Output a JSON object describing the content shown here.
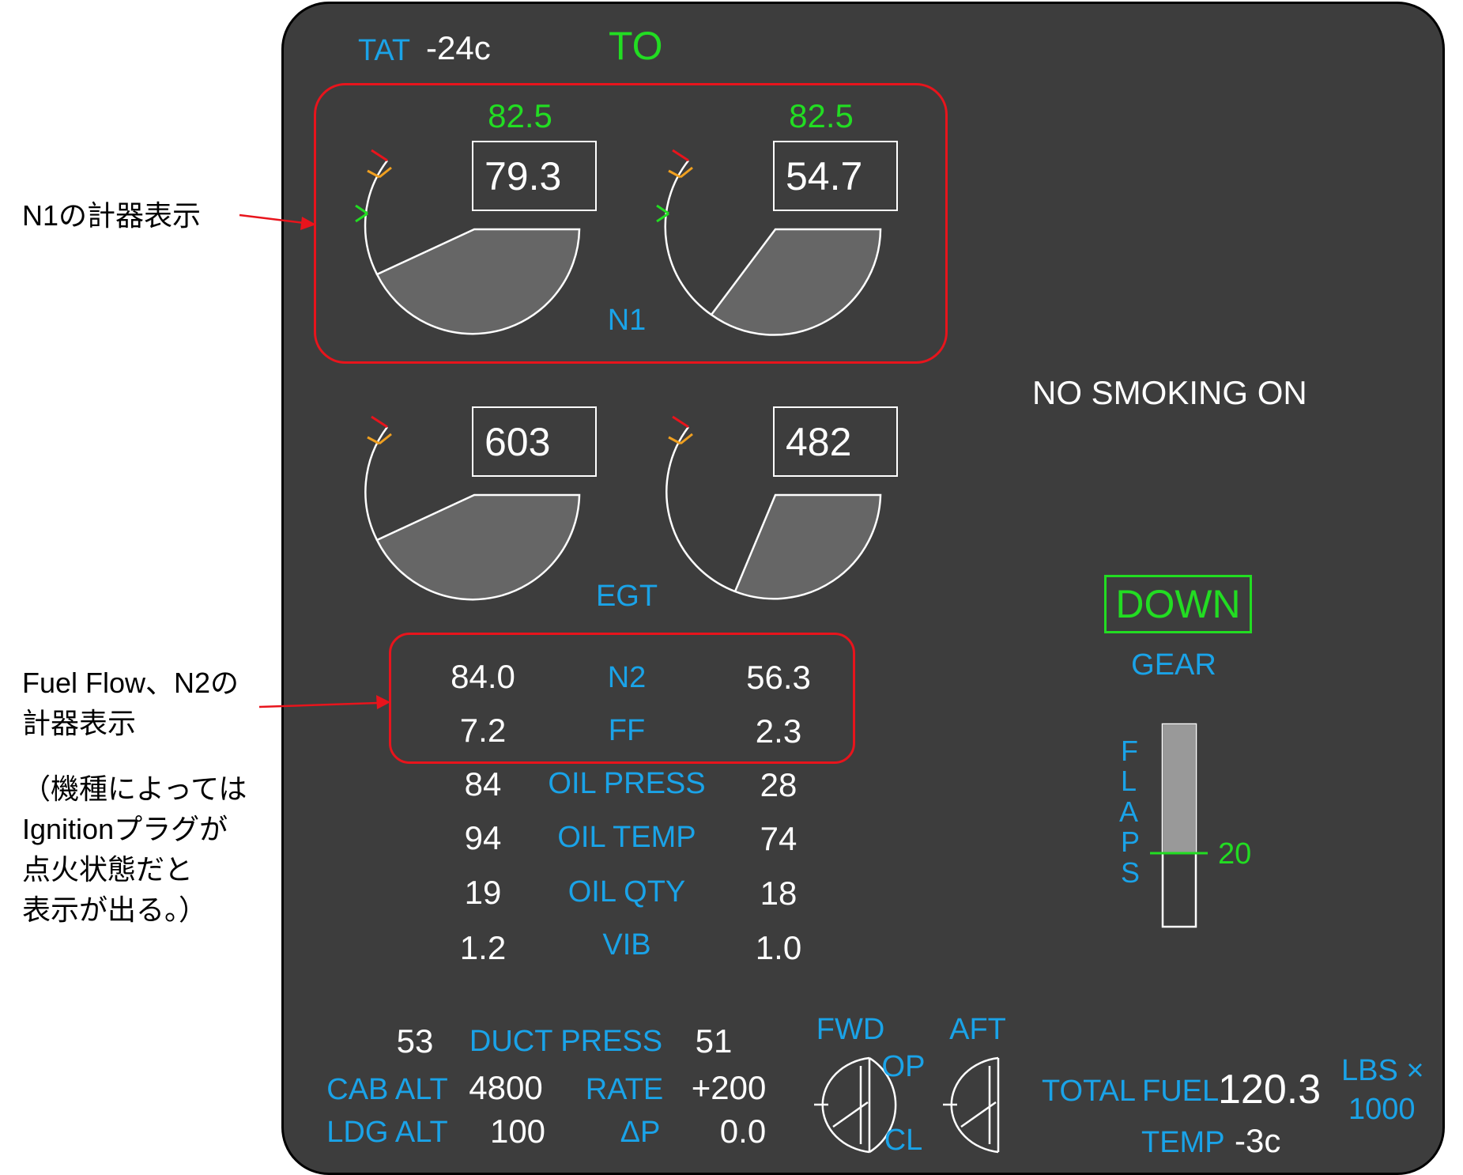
{
  "tat": {
    "label": "TAT",
    "value": "-24c"
  },
  "mode": "TO",
  "n1": {
    "label": "N1",
    "target_left": "82.5",
    "target_right": "82.5",
    "left": "79.3",
    "right": "54.7"
  },
  "egt": {
    "label": "EGT",
    "left": "603",
    "right": "482"
  },
  "secondary": {
    "rows": [
      {
        "label": "N2",
        "left": "84.0",
        "right": "56.3"
      },
      {
        "label": "FF",
        "left": "7.2",
        "right": "2.3"
      },
      {
        "label": "OIL PRESS",
        "left": "84",
        "right": "28"
      },
      {
        "label": "OIL TEMP",
        "left": "94",
        "right": "74"
      },
      {
        "label": "OIL QTY",
        "left": "19",
        "right": "18"
      },
      {
        "label": "VIB",
        "left": "1.2",
        "right": "1.0"
      }
    ]
  },
  "no_smoking": "NO SMOKING ON",
  "gear": {
    "state": "DOWN",
    "label": "GEAR"
  },
  "flaps": {
    "letters": [
      "F",
      "L",
      "A",
      "P",
      "S"
    ],
    "value": "20"
  },
  "pressurization": {
    "duct_left": "53",
    "duct_label": "DUCT PRESS",
    "duct_right": "51",
    "cab_alt_label": "CAB ALT",
    "cab_alt": "4800",
    "rate_label": "RATE",
    "rate": "+200",
    "ldg_alt_label": "LDG ALT",
    "ldg_alt": "100",
    "dp_label": "ΔP",
    "dp": "0.0"
  },
  "valve": {
    "fwd": "FWD",
    "aft": "AFT",
    "op": "OP",
    "cl": "CL"
  },
  "fuel": {
    "total_label": "TOTAL",
    "fuel_label": "FUEL",
    "total": "120.3",
    "unit_line1": "LBS ×",
    "unit_line2": "1000",
    "temp_label": "TEMP",
    "temp": "-3c"
  },
  "annotations": {
    "n1": "N1の計器表示",
    "ff_n2_line1": "Fuel Flow、N2の",
    "ff_n2_line2": "計器表示",
    "ign_line1": "（機種によっては",
    "ign_line2": "Ignitionプラグが",
    "ign_line3": "点火状態だと",
    "ign_line4": "表示が出る。）"
  },
  "colors": {
    "panel": "#3d3d3d",
    "cyan": "#1aa3e8",
    "green": "#22dd22",
    "red": "#e8141c",
    "amber": "#f0a020",
    "gauge_fill": "#666666"
  }
}
